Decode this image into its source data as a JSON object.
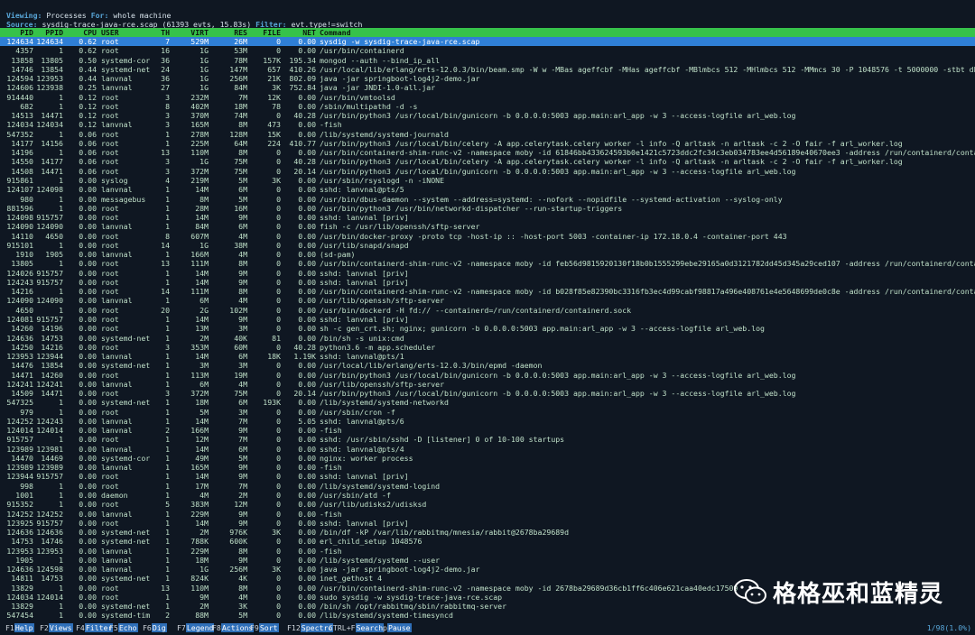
{
  "header": {
    "viewing_key": "Viewing:",
    "viewing_val": "Processes",
    "for_key": "For:",
    "for_val": "whole machine",
    "source_key": "Source:",
    "source_val": "sysdig-trace-java-rce.scap (61393 evts, 15.83s)",
    "filter_key": "Filter:",
    "filter_val": "evt.type!=switch"
  },
  "columns": [
    "PID",
    "PPID",
    "CPU",
    "USER",
    "TH",
    "VIRT",
    "RES",
    "FILE",
    "NET",
    "Command"
  ],
  "rows": [
    [
      "124634",
      "124634",
      "0.62",
      "root",
      "7",
      "529M",
      "26M",
      "0",
      "0.00",
      "sysdig -w sysdig-trace-java-rce.scap"
    ],
    [
      "4357",
      "1",
      "0.62",
      "root",
      "16",
      "1G",
      "53M",
      "0",
      "0.00",
      "/usr/bin/containerd"
    ],
    [
      "13858",
      "13805",
      "0.50",
      "systemd-cor",
      "36",
      "1G",
      "78M",
      "157K",
      "195.34",
      "mongod --auth --bind_ip_all"
    ],
    [
      "14746",
      "13854",
      "0.44",
      "systemd-net",
      "24",
      "1G",
      "147M",
      "657",
      "410.26",
      "/usr/local/lib/erlang/erts-12.0.3/bin/beam.smp -W w -MBas ageffcbf -MHas ageffcbf -MBlmbcs 512 -MHlmbcs 512 -MMmcs 30 -P 1048576 -t 5000000 -stbt db -zdbbl"
    ],
    [
      "124594",
      "123953",
      "0.44",
      "lanvnal",
      "36",
      "1G",
      "256M",
      "21K",
      "802.09",
      "java -jar springboot-log4j2-demo.jar"
    ],
    [
      "124606",
      "123938",
      "0.25",
      "lanvnal",
      "27",
      "1G",
      "84M",
      "3K",
      "752.84",
      "java -jar JNDI-1.0-all.jar"
    ],
    [
      "914440",
      "1",
      "0.12",
      "root",
      "3",
      "232M",
      "7M",
      "12K",
      "0.00",
      "/usr/bin/vmtoolsd"
    ],
    [
      "682",
      "1",
      "0.12",
      "root",
      "8",
      "402M",
      "18M",
      "78",
      "0.00",
      "/sbin/multipathd -d -s"
    ],
    [
      "14513",
      "14471",
      "0.12",
      "root",
      "3",
      "370M",
      "74M",
      "0",
      "40.28",
      "/usr/bin/python3 /usr/local/bin/gunicorn -b 0.0.0.0:5003 app.main:arl_app -w 3 --access-logfile arl_web.log"
    ],
    [
      "124034",
      "124034",
      "0.12",
      "lanvnal",
      "3",
      "165M",
      "8M",
      "473",
      "0.00",
      "-fish"
    ],
    [
      "547352",
      "1",
      "0.06",
      "root",
      "1",
      "278M",
      "128M",
      "15K",
      "0.00",
      "/lib/systemd/systemd-journald"
    ],
    [
      "14177",
      "14156",
      "0.06",
      "root",
      "1",
      "225M",
      "64M",
      "224",
      "410.77",
      "/usr/bin/python3 /usr/local/bin/celery -A app.celerytask.celery worker -l info -Q arltask -n arltask -c 2 -O fair -f arl_worker.log"
    ],
    [
      "14196",
      "1",
      "0.06",
      "root",
      "13",
      "110M",
      "8M",
      "0",
      "0.00",
      "/usr/bin/containerd-shim-runc-v2 -namespace moby -id 61846bb433624593b0e1421c5723ddc2fc3dc3eb034783ee4d56189e40670ee3 -address /run/containerd/containerd.sock"
    ],
    [
      "14550",
      "14177",
      "0.06",
      "root",
      "3",
      "1G",
      "75M",
      "0",
      "40.28",
      "/usr/bin/python3 /usr/local/bin/celery -A app.celerytask.celery worker -l info -Q arltask -n arltask -c 2 -O fair -f arl_worker.log"
    ],
    [
      "14508",
      "14471",
      "0.06",
      "root",
      "3",
      "372M",
      "75M",
      "0",
      "20.14",
      "/usr/bin/python3 /usr/local/bin/gunicorn -b 0.0.0.0:5003 app.main:arl_app -w 3 --access-logfile arl_web.log"
    ],
    [
      "915861",
      "1",
      "0.00",
      "syslog",
      "4",
      "219M",
      "5M",
      "3K",
      "0.00",
      "/usr/sbin/rsyslogd -n -iNONE"
    ],
    [
      "124107",
      "124098",
      "0.00",
      "lanvnal",
      "1",
      "14M",
      "6M",
      "0",
      "0.00",
      "sshd: lanvnal@pts/5"
    ],
    [
      "980",
      "1",
      "0.00",
      "messagebus",
      "1",
      "8M",
      "5M",
      "0",
      "0.00",
      "/usr/bin/dbus-daemon --system --address=systemd: --nofork --nopidfile --systemd-activation --syslog-only"
    ],
    [
      "881596",
      "1",
      "0.00",
      "root",
      "1",
      "28M",
      "16M",
      "0",
      "0.00",
      "/usr/bin/python3 /usr/bin/networkd-dispatcher --run-startup-triggers"
    ],
    [
      "124098",
      "915757",
      "0.00",
      "root",
      "1",
      "14M",
      "9M",
      "0",
      "0.00",
      "sshd: lanvnal [priv]"
    ],
    [
      "124090",
      "124090",
      "0.00",
      "lanvnal",
      "1",
      "84M",
      "6M",
      "0",
      "0.00",
      "fish -c /usr/lib/openssh/sftp-server"
    ],
    [
      "14110",
      "4650",
      "0.00",
      "root",
      "8",
      "607M",
      "4M",
      "0",
      "0.00",
      "/usr/bin/docker-proxy -proto tcp -host-ip :: -host-port 5003 -container-ip 172.18.0.4 -container-port 443"
    ],
    [
      "915101",
      "1",
      "0.00",
      "root",
      "14",
      "1G",
      "38M",
      "0",
      "0.00",
      "/usr/lib/snapd/snapd"
    ],
    [
      "1910",
      "1905",
      "0.00",
      "lanvnal",
      "1",
      "166M",
      "4M",
      "0",
      "0.00",
      "(sd-pam)"
    ],
    [
      "13805",
      "1",
      "0.00",
      "root",
      "13",
      "111M",
      "8M",
      "0",
      "0.00",
      "/usr/bin/containerd-shim-runc-v2 -namespace moby -id feb56d9815920130f18b0b1555299ebe29165a0d3121782dd45d345a29ced107 -address /run/containerd/containerd.sock"
    ],
    [
      "124026",
      "915757",
      "0.00",
      "root",
      "1",
      "14M",
      "9M",
      "0",
      "0.00",
      "sshd: lanvnal [priv]"
    ],
    [
      "124243",
      "915757",
      "0.00",
      "root",
      "1",
      "14M",
      "9M",
      "0",
      "0.00",
      "sshd: lanvnal [priv]"
    ],
    [
      "14216",
      "1",
      "0.00",
      "root",
      "14",
      "111M",
      "8M",
      "0",
      "0.00",
      "/usr/bin/containerd-shim-runc-v2 -namespace moby -id b028f85e82390bc3316fb3ec4d99cabf98817a496e408761e4e5648699de0c8e -address /run/containerd/containerd.sock"
    ],
    [
      "124090",
      "124090",
      "0.00",
      "lanvnal",
      "1",
      "6M",
      "4M",
      "0",
      "0.00",
      "/usr/lib/openssh/sftp-server"
    ],
    [
      "4650",
      "1",
      "0.00",
      "root",
      "20",
      "2G",
      "102M",
      "0",
      "0.00",
      "/usr/bin/dockerd -H fd:// --containerd=/run/containerd/containerd.sock"
    ],
    [
      "124081",
      "915757",
      "0.00",
      "root",
      "1",
      "14M",
      "9M",
      "0",
      "0.00",
      "sshd: lanvnal [priv]"
    ],
    [
      "14260",
      "14196",
      "0.00",
      "root",
      "1",
      "13M",
      "3M",
      "0",
      "0.00",
      "sh -c gen_crt.sh; nginx; gunicorn -b 0.0.0.0:5003 app.main:arl_app -w 3 --access-logfile arl_web.log"
    ],
    [
      "124636",
      "14753",
      "0.00",
      "systemd-net",
      "1",
      "2M",
      "40K",
      "81",
      "0.00",
      "/bin/sh -s unix:cmd"
    ],
    [
      "14250",
      "14216",
      "0.00",
      "root",
      "3",
      "353M",
      "60M",
      "0",
      "40.28",
      "python3.6 -m app.scheduler"
    ],
    [
      "123953",
      "123944",
      "0.00",
      "lanvnal",
      "1",
      "14M",
      "6M",
      "18K",
      "1.19K",
      "sshd: lanvnal@pts/1"
    ],
    [
      "14476",
      "13854",
      "0.00",
      "systemd-net",
      "1",
      "3M",
      "3M",
      "0",
      "0.00",
      "/usr/local/lib/erlang/erts-12.0.3/bin/epmd -daemon"
    ],
    [
      "14471",
      "14260",
      "0.00",
      "root",
      "1",
      "113M",
      "19M",
      "0",
      "0.00",
      "/usr/bin/python3 /usr/local/bin/gunicorn -b 0.0.0.0:5003 app.main:arl_app -w 3 --access-logfile arl_web.log"
    ],
    [
      "124241",
      "124241",
      "0.00",
      "lanvnal",
      "1",
      "6M",
      "4M",
      "0",
      "0.00",
      "/usr/lib/openssh/sftp-server"
    ],
    [
      "14509",
      "14471",
      "0.00",
      "root",
      "3",
      "372M",
      "75M",
      "0",
      "20.14",
      "/usr/bin/python3 /usr/local/bin/gunicorn -b 0.0.0.0:5003 app.main:arl_app -w 3 --access-logfile arl_web.log"
    ],
    [
      "547325",
      "1",
      "0.00",
      "systemd-net",
      "1",
      "18M",
      "6M",
      "193K",
      "0.00",
      "/lib/systemd/systemd-networkd"
    ],
    [
      "979",
      "1",
      "0.00",
      "root",
      "1",
      "5M",
      "3M",
      "0",
      "0.00",
      "/usr/sbin/cron -f"
    ],
    [
      "124252",
      "124243",
      "0.00",
      "lanvnal",
      "1",
      "14M",
      "7M",
      "0",
      "5.05",
      "sshd: lanvnal@pts/6"
    ],
    [
      "124014",
      "124014",
      "0.00",
      "lanvnal",
      "2",
      "166M",
      "9M",
      "0",
      "0.00",
      "-fish"
    ],
    [
      "915757",
      "1",
      "0.00",
      "root",
      "1",
      "12M",
      "7M",
      "0",
      "0.00",
      "sshd: /usr/sbin/sshd -D [listener] 0 of 10-100 startups"
    ],
    [
      "123989",
      "123981",
      "0.00",
      "lanvnal",
      "1",
      "14M",
      "6M",
      "0",
      "0.00",
      "sshd: lanvnal@pts/4"
    ],
    [
      "14470",
      "14469",
      "0.00",
      "systemd-cor",
      "1",
      "49M",
      "5M",
      "0",
      "0.00",
      "nginx: worker process"
    ],
    [
      "123989",
      "123989",
      "0.00",
      "lanvnal",
      "1",
      "165M",
      "9M",
      "0",
      "0.00",
      "-fish"
    ],
    [
      "123944",
      "915757",
      "0.00",
      "root",
      "1",
      "14M",
      "9M",
      "0",
      "0.00",
      "sshd: lanvnal [priv]"
    ],
    [
      "998",
      "1",
      "0.00",
      "root",
      "1",
      "17M",
      "7M",
      "0",
      "0.00",
      "/lib/systemd/systemd-logind"
    ],
    [
      "1001",
      "1",
      "0.00",
      "daemon",
      "1",
      "4M",
      "2M",
      "0",
      "0.00",
      "/usr/sbin/atd -f"
    ],
    [
      "915352",
      "1",
      "0.00",
      "root",
      "5",
      "383M",
      "12M",
      "0",
      "0.00",
      "/usr/lib/udisks2/udisksd"
    ],
    [
      "124252",
      "124252",
      "0.00",
      "lanvnal",
      "1",
      "229M",
      "9M",
      "0",
      "0.00",
      "-fish"
    ],
    [
      "123925",
      "915757",
      "0.00",
      "root",
      "1",
      "14M",
      "9M",
      "0",
      "0.00",
      "sshd: lanvnal [priv]"
    ],
    [
      "124636",
      "124636",
      "0.00",
      "systemd-net",
      "1",
      "2M",
      "976K",
      "3K",
      "0.00",
      "/bin/df -kP /var/lib/rabbitmq/mnesia/rabbit@2678ba29689d"
    ],
    [
      "14753",
      "14746",
      "0.00",
      "systemd-net",
      "1",
      "788K",
      "600K",
      "0",
      "0.00",
      "erl_child_setup 1048576"
    ],
    [
      "123953",
      "123953",
      "0.00",
      "lanvnal",
      "1",
      "229M",
      "8M",
      "0",
      "0.00",
      "-fish"
    ],
    [
      "1905",
      "1",
      "0.00",
      "lanvnal",
      "1",
      "18M",
      "9M",
      "0",
      "0.00",
      "/lib/systemd/systemd --user"
    ],
    [
      "124636",
      "124598",
      "0.00",
      "lanvnal",
      "1",
      "1G",
      "256M",
      "3K",
      "0.00",
      "java -jar springboot-log4j2-demo.jar"
    ],
    [
      "14811",
      "14753",
      "0.00",
      "systemd-net",
      "1",
      "824K",
      "4K",
      "0",
      "0.00",
      "inet_gethost 4"
    ],
    [
      "13829",
      "1",
      "0.00",
      "root",
      "13",
      "110M",
      "8M",
      "0",
      "0.00",
      "/usr/bin/containerd-shim-runc-v2 -namespace moby -id 2678ba29689d36cb1ff6c406e621caa40edc17509"
    ],
    [
      "124034",
      "124014",
      "0.00",
      "root",
      "1",
      "9M",
      "4M",
      "0",
      "0.00",
      "sudo sysdig -w sysdig-trace-java-rce.scap"
    ],
    [
      "13829",
      "1",
      "0.00",
      "systemd-net",
      "1",
      "2M",
      "3K",
      "0",
      "0.00",
      "/bin/sh /opt/rabbitmq/sbin/rabbitmq-server"
    ],
    [
      "547454",
      "1",
      "0.00",
      "systemd-tim",
      "2",
      "88M",
      "5M",
      "0",
      "0.00",
      "/lib/systemd/systemd-timesyncd"
    ]
  ],
  "fkeys": [
    {
      "key": "F1",
      "label": "Help"
    },
    {
      "key": "F2",
      "label": "Views"
    },
    {
      "key": "F4",
      "label": "Filter"
    },
    {
      "key": "F5",
      "label": "Echo"
    },
    {
      "key": "F6",
      "label": "Dig"
    },
    {
      "key": "F7",
      "label": "Legend"
    },
    {
      "key": "F8",
      "label": "Actions"
    },
    {
      "key": "F9",
      "label": "Sort"
    },
    {
      "key": "F12",
      "label": "Spectro"
    },
    {
      "key": "CTRL+F",
      "label": "Search"
    },
    {
      "key": "p",
      "label": "Pause"
    }
  ],
  "status": "1/98(1.0%)",
  "watermark": "格格巫和蓝精灵",
  "colors": {
    "header_bar": "#36c24a",
    "selected_row": "#2f7fd6",
    "fkey_label": "#2f6fb8",
    "bg": "#0f1722"
  }
}
